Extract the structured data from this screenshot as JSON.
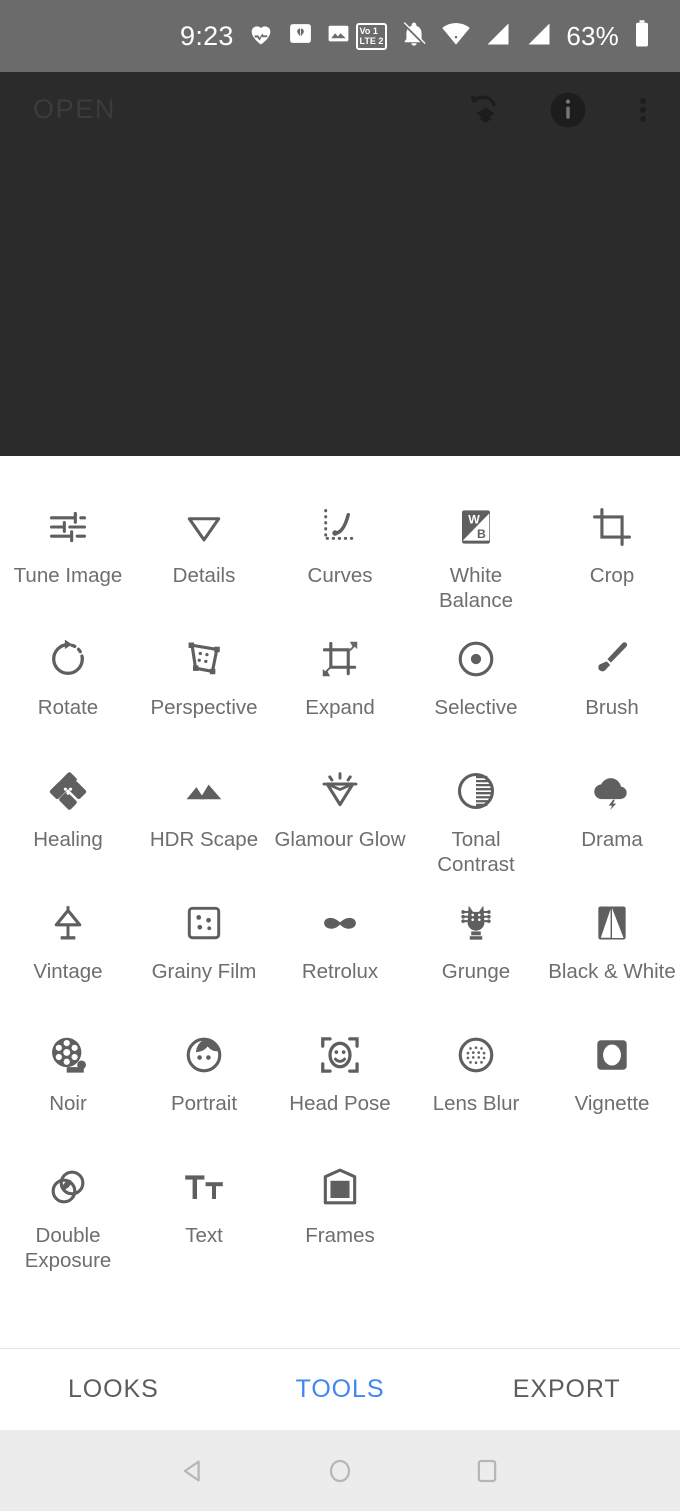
{
  "status_bar": {
    "time": "9:23",
    "battery_percent": "63%",
    "volte_line1": "Vo 1",
    "volte_line2": "LTE 2",
    "left_icons": [
      "heart-health-icon",
      "cards-icon",
      "photo-icon"
    ],
    "right_icons": [
      "volte-icon",
      "notifications-silenced-icon",
      "wifi-icon",
      "signal-1-icon",
      "signal-2-icon",
      "battery-icon"
    ],
    "background": "#6b6b6b",
    "foreground": "#ffffff"
  },
  "app_bar": {
    "open_label": "OPEN",
    "icons": [
      "undo-stack-icon",
      "info-icon",
      "overflow-menu-icon"
    ],
    "background": "#2b2b2b"
  },
  "canvas": {
    "background": "#2b2b2b"
  },
  "tools": [
    {
      "label": "Tune Image",
      "icon": "tune-image-icon"
    },
    {
      "label": "Details",
      "icon": "details-icon"
    },
    {
      "label": "Curves",
      "icon": "curves-icon"
    },
    {
      "label": "White Balance",
      "icon": "white-balance-icon"
    },
    {
      "label": "Crop",
      "icon": "crop-icon"
    },
    {
      "label": "Rotate",
      "icon": "rotate-icon"
    },
    {
      "label": "Perspective",
      "icon": "perspective-icon"
    },
    {
      "label": "Expand",
      "icon": "expand-icon"
    },
    {
      "label": "Selective",
      "icon": "selective-icon"
    },
    {
      "label": "Brush",
      "icon": "brush-icon"
    },
    {
      "label": "Healing",
      "icon": "healing-icon"
    },
    {
      "label": "HDR Scape",
      "icon": "hdr-scape-icon"
    },
    {
      "label": "Glamour Glow",
      "icon": "glamour-glow-icon"
    },
    {
      "label": "Tonal Contrast",
      "icon": "tonal-contrast-icon"
    },
    {
      "label": "Drama",
      "icon": "drama-icon"
    },
    {
      "label": "Vintage",
      "icon": "vintage-icon"
    },
    {
      "label": "Grainy Film",
      "icon": "grainy-film-icon"
    },
    {
      "label": "Retrolux",
      "icon": "retrolux-icon"
    },
    {
      "label": "Grunge",
      "icon": "grunge-icon"
    },
    {
      "label": "Black & White",
      "icon": "black-and-white-icon"
    },
    {
      "label": "Noir",
      "icon": "noir-icon"
    },
    {
      "label": "Portrait",
      "icon": "portrait-icon"
    },
    {
      "label": "Head Pose",
      "icon": "head-pose-icon"
    },
    {
      "label": "Lens Blur",
      "icon": "lens-blur-icon"
    },
    {
      "label": "Vignette",
      "icon": "vignette-icon"
    },
    {
      "label": "Double Exposure",
      "icon": "double-exposure-icon"
    },
    {
      "label": "Text",
      "icon": "text-icon"
    },
    {
      "label": "Frames",
      "icon": "frames-icon"
    }
  ],
  "tab_bar": {
    "tabs": [
      {
        "label": "LOOKS",
        "active": false
      },
      {
        "label": "TOOLS",
        "active": true
      },
      {
        "label": "EXPORT",
        "active": false
      }
    ],
    "active_color": "#4285f4",
    "inactive_color": "#5c5c5c"
  },
  "nav_bar": {
    "buttons": [
      "back-icon",
      "home-icon",
      "recents-icon"
    ],
    "background": "#ececec"
  }
}
